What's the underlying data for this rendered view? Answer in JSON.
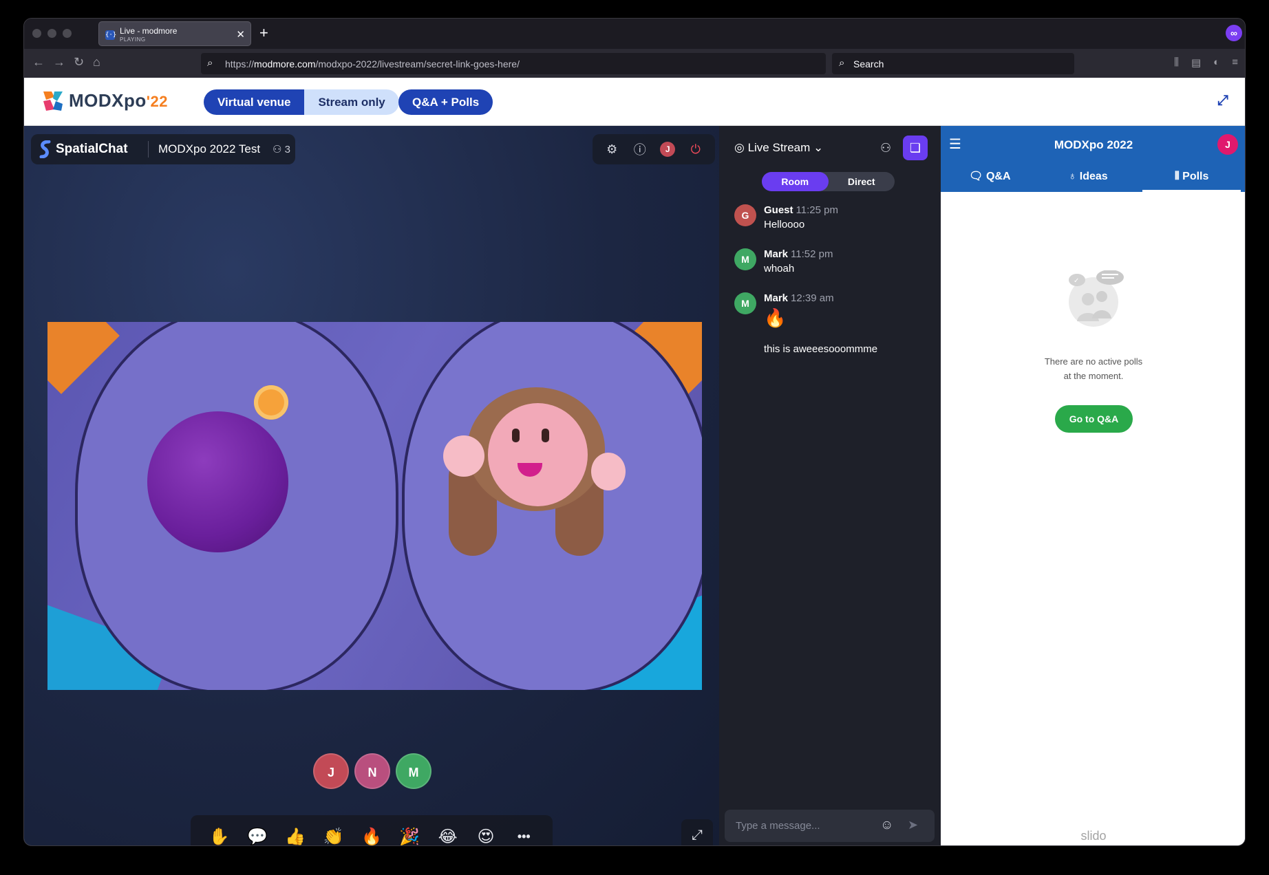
{
  "browser": {
    "tab_title": "Live - modmore",
    "tab_status": "PLAYING",
    "url_prefix": "https://",
    "url_domain": "modmore.com",
    "url_path": "/modxpo-2022/livestream/secret-link-goes-here/",
    "search_placeholder": "Search"
  },
  "site": {
    "logo_text": "MODXpo",
    "logo_year": "'22",
    "nav": {
      "virtual_venue": "Virtual venue",
      "stream_only": "Stream only",
      "qa_polls": "Q&A + Polls"
    }
  },
  "spatial": {
    "brand": "SpatialChat",
    "room_name": "MODXpo 2022 Test",
    "participant_count": "3",
    "user_initial": "J",
    "participants": [
      {
        "initial": "J",
        "color": "#c24a56"
      },
      {
        "initial": "N",
        "color": "#b94f7e"
      },
      {
        "initial": "M",
        "color": "#3fa863"
      }
    ],
    "reactions": [
      "✋",
      "💬",
      "👍",
      "👏",
      "🔥",
      "🎉",
      "😂",
      "😍",
      "•••"
    ]
  },
  "chat": {
    "channel": "Live Stream",
    "toggle_room": "Room",
    "toggle_direct": "Direct",
    "messages": [
      {
        "initial": "G",
        "name": "Guest",
        "time": "11:25 pm",
        "text": "Helloooo",
        "color": "#c0524f"
      },
      {
        "initial": "M",
        "name": "Mark",
        "time": "11:52 pm",
        "text": "whoah",
        "color": "#3fa863"
      },
      {
        "initial": "M",
        "name": "Mark",
        "time": "12:39 am",
        "text": "🔥",
        "color": "#3fa863"
      }
    ],
    "followup_text": "this is aweeesooommme",
    "input_placeholder": "Type a message..."
  },
  "slido": {
    "event_title": "MODXpo 2022",
    "user_initial": "J",
    "tabs": {
      "qa": "Q&A",
      "ideas": "Ideas",
      "polls": "Polls"
    },
    "empty_line1": "There are no active polls",
    "empty_line2": "at the moment.",
    "goto_qa": "Go to Q&A",
    "brand": "slido"
  },
  "colors": {
    "accent_blue": "#1f43b4",
    "slido_blue": "#1e63b6",
    "chat_purple": "#6a3df0",
    "go_green": "#2aa94a"
  }
}
